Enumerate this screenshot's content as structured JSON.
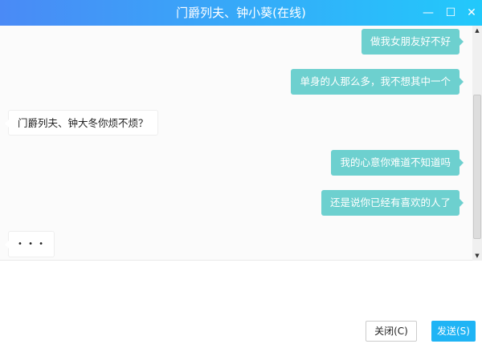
{
  "window": {
    "title": "门爵列夫、钟小葵(在线)",
    "minimize_icon": "—",
    "maximize_icon": "☐",
    "close_icon": "✕"
  },
  "messages": [
    {
      "side": "me",
      "text": "做我女朋友好不好"
    },
    {
      "side": "me",
      "text": "单身的人那么多，我不想其中一个"
    },
    {
      "side": "other",
      "text": "门爵列夫、钟大冬你烦不烦？"
    },
    {
      "side": "me",
      "text": "我的心意你难道不知道吗"
    },
    {
      "side": "me",
      "text": "还是说你已经有喜欢的人了"
    },
    {
      "side": "other",
      "text": "• • •"
    }
  ],
  "buttons": {
    "close": "关闭(C)",
    "send": "发送(S)"
  },
  "colors": {
    "accent": "#1fb4f5",
    "bubble_me": "#6dd0cf"
  }
}
